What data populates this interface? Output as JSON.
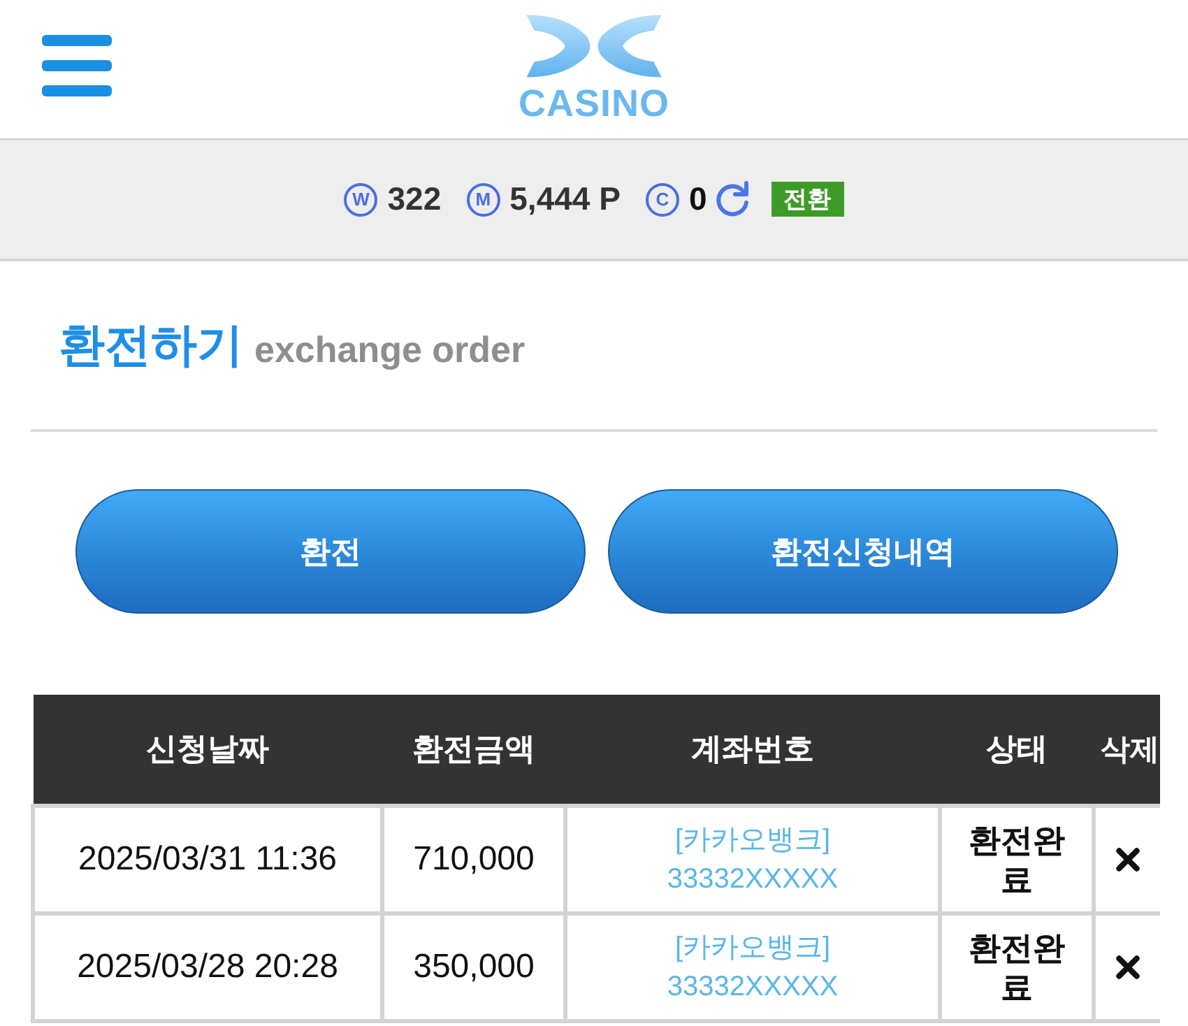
{
  "header": {
    "logo_text": "CASINO"
  },
  "balance_bar": {
    "items": [
      {
        "symbol": "W",
        "value": "322"
      },
      {
        "symbol": "M",
        "value": "5,444 P"
      },
      {
        "symbol": "C",
        "value": "0"
      }
    ],
    "convert_button": "전환"
  },
  "section": {
    "title": "환전하기",
    "subtitle": "exchange order"
  },
  "actions": [
    "환전",
    "환전신청내역"
  ],
  "table": {
    "columns": [
      "신청날짜",
      "환전금액",
      "계좌번호",
      "상태",
      "삭제"
    ],
    "rows": [
      {
        "date": "2025/03/31 11:36",
        "amount": "710,000",
        "bank": "[카카오뱅크]",
        "account": "33332XXXXX",
        "status": "환전완료"
      },
      {
        "date": "2025/03/28 20:28",
        "amount": "350,000",
        "bank": "[카카오뱅크]",
        "account": "33332XXXXX",
        "status": "환전완료"
      }
    ]
  }
}
